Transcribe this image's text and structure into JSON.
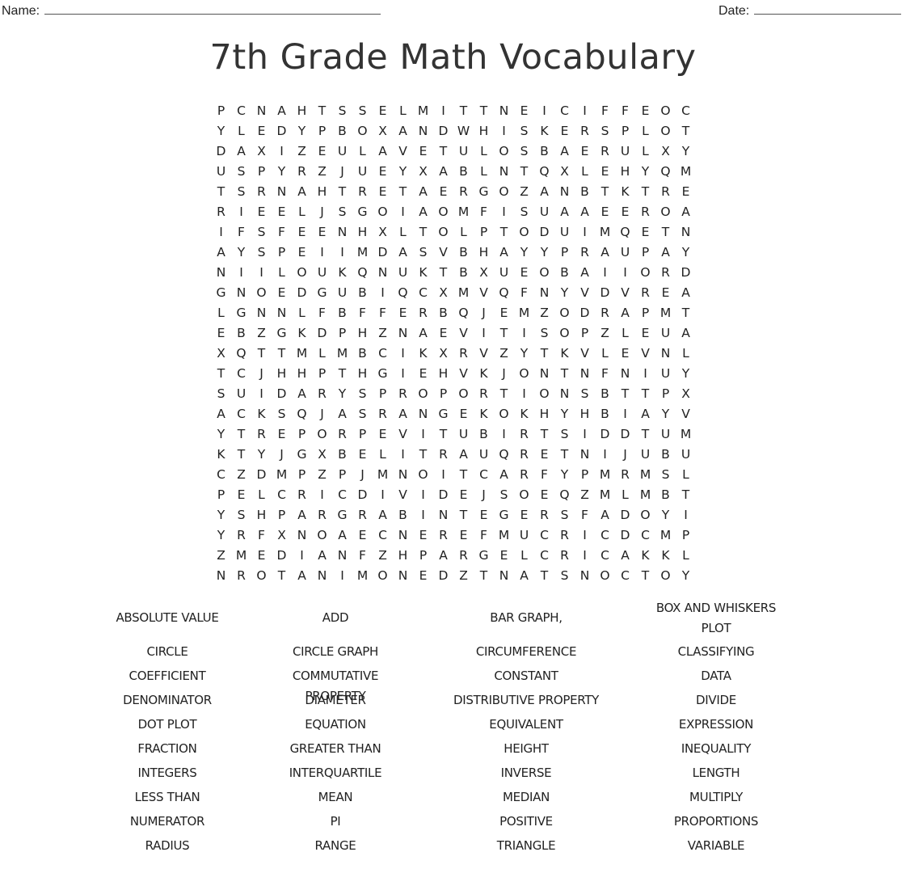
{
  "header": {
    "name_label": "Name:",
    "date_label": "Date:"
  },
  "title": "7th Grade Math Vocabulary",
  "grid": [
    "PCNAHTSSELMITTNEICIFFEOC",
    "YLEDYPBOXANDWHISKERSPLOT",
    "DAXIZEULAVETULOSBAERULXY",
    "USPYRZJUEYXABLNTQXLEHYQM",
    "TSRNAHTRETAERGOZANBTKTRE",
    "RIEELJSGOIAOMFISUAAEEROA",
    "IFSFEENHXLTOLPTODUIMQETN",
    "AYSPEIIMDASVBHAYYPRAUPAY",
    "NIILOUKQNUKTBXUEOBAIIORD",
    "GNOEDGUBIQCXMVQFNYVDVREA",
    "LGNNLFBFFERBQJEMZODRAPMT",
    "EBZGKDPHZNAEVITISOPZLEUA",
    "XQTTMLMBCIKXRVZYTKVLEVNL",
    "TCJHHPTHGIEHVKJONTNFNIUY",
    "SUIDARYSPROPORTIONSBTTPX",
    "ACKSQJASRANGEKOKHYHBIAYV",
    "YTREPORPEVITUBIRTSIDDTUM",
    "KTYJGXBELITRAUQRETNIJUBU",
    "CZDMPZPJMNOITCARFYPMRMSL",
    "PELCRICDIVIDEJSOEQZMLMBT",
    "YSHPARGRABINTEGERSFADOYI",
    "YRFXNOAECNEREFMUCRICDCMP",
    "ZMEDIANFZHPARGELCRICAKKL",
    "NROTANIMONEDZTNATSNOCTOY"
  ],
  "words": [
    "ABSOLUTE VALUE",
    "ADD",
    "BAR GRAPH,",
    "BOX AND WHISKERS PLOT",
    "CIRCLE",
    "CIRCLE GRAPH",
    "CIRCUMFERENCE",
    "CLASSIFYING",
    "COEFFICIENT",
    "COMMUTATIVE PROPERTY",
    "CONSTANT",
    "DATA",
    "DENOMINATOR",
    "DIAMETER",
    "DISTRIBUTIVE PROPERTY",
    "DIVIDE",
    "DOT PLOT",
    "EQUATION",
    "EQUIVALENT",
    "EXPRESSION",
    "FRACTION",
    "GREATER THAN",
    "HEIGHT",
    "INEQUALITY",
    "INTEGERS",
    "INTERQUARTILE",
    "INVERSE",
    "LENGTH",
    "LESS THAN",
    "MEAN",
    "MEDIAN",
    "MULTIPLY",
    "NUMERATOR",
    "PI",
    "POSITIVE",
    "PROPORTIONS",
    "RADIUS",
    "RANGE",
    "TRIANGLE",
    "VARIABLE"
  ]
}
